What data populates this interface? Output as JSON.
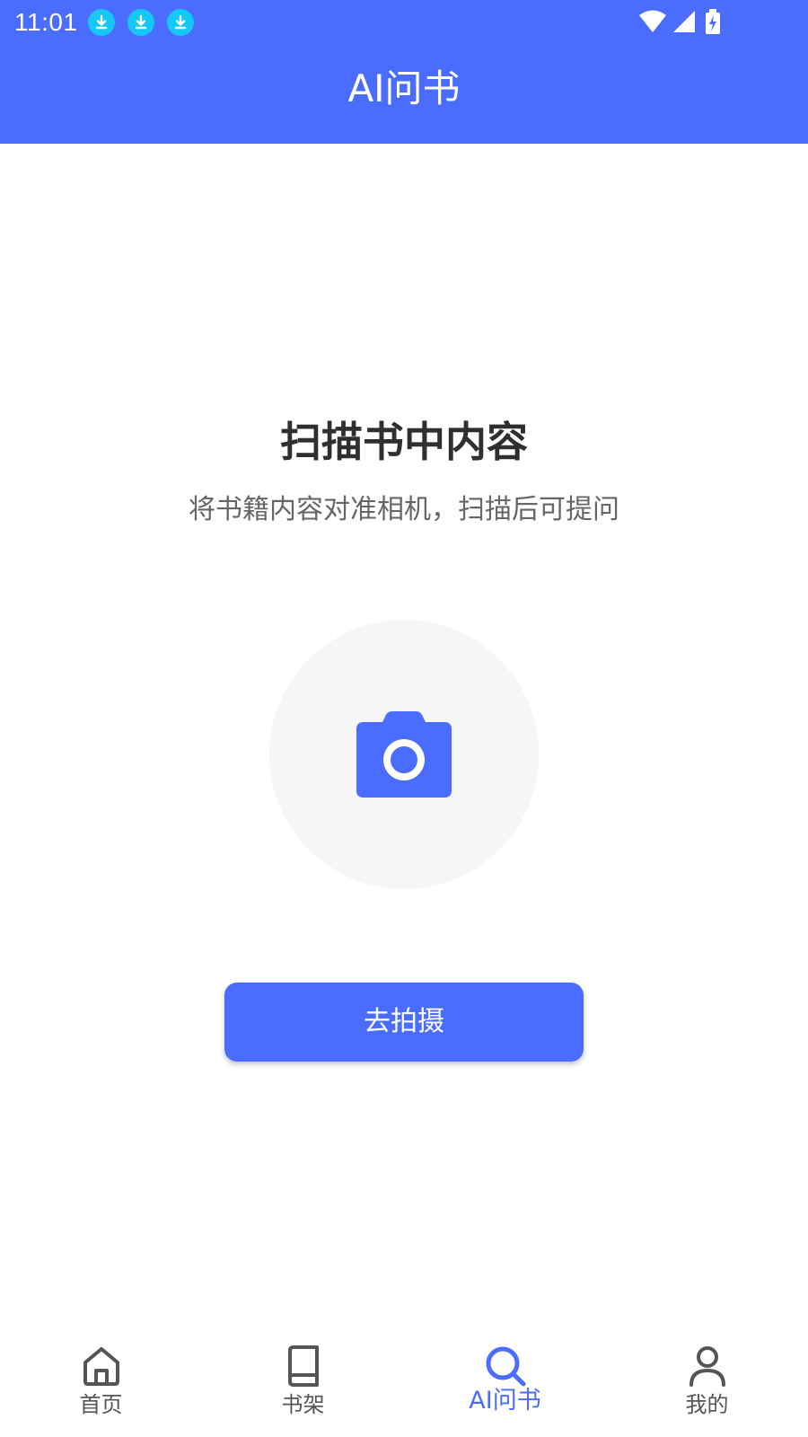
{
  "status_bar": {
    "time": "11:01",
    "notification_icons": [
      "download-icon",
      "download-icon",
      "download-icon"
    ],
    "right_icons": [
      "wifi-icon",
      "signal-icon",
      "battery-charging-icon"
    ]
  },
  "app_bar": {
    "title": "AI问书"
  },
  "main": {
    "heading": "扫描书中内容",
    "subheading": "将书籍内容对准相机，扫描后可提问",
    "camera_icon": "camera-icon",
    "button_label": "去拍摄"
  },
  "bottom_nav": {
    "items": [
      {
        "label": "首页",
        "icon": "home-icon"
      },
      {
        "label": "书架",
        "icon": "book-icon"
      },
      {
        "label": "AI问书",
        "icon": "search-icon",
        "active": true
      },
      {
        "label": "我的",
        "icon": "user-icon"
      }
    ]
  },
  "colors": {
    "primary": "#4A6CFF",
    "notification": "#14C7F4",
    "heading_text": "#2F2F2F",
    "sub_text": "#666666",
    "nav_inactive": "#555555",
    "circle_bg": "#F6F6F6"
  }
}
